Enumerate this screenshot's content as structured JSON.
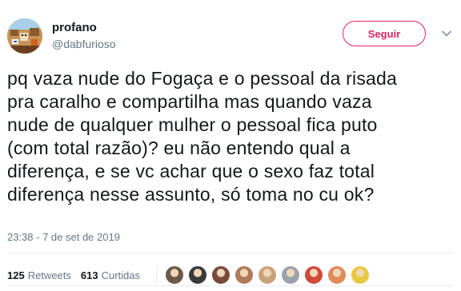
{
  "tweet": {
    "display_name": "profano",
    "handle": "@dabfurioso",
    "follow_label": "Seguir",
    "text": "pq vaza nude do Fogaça e o pessoal da risada\npra caralho e compartilha mas quando vaza\nnude de qualquer mulher o pessoal fica puto\n(com total razão)? eu não entendo qual a\ndiferença, e se vc achar que o sexo faz total\ndiferença nesse assunto, só toma no cu ok?",
    "timestamp": "23:38 - 7 de set de 2019",
    "retweets_count": "125",
    "retweets_label": "Retweets",
    "likes_count": "613",
    "likes_label": "Curtidas"
  },
  "colors": {
    "follow_accent": "#e0245e",
    "secondary_text": "#657786",
    "primary_text": "#14171a"
  },
  "likers": [
    {
      "icon": "liker-avatar-1",
      "color": "#6b5a4a"
    },
    {
      "icon": "liker-avatar-2",
      "color": "#3a3a3a"
    },
    {
      "icon": "liker-avatar-3",
      "color": "#7a4a3a"
    },
    {
      "icon": "liker-avatar-4",
      "color": "#b07a5a"
    },
    {
      "icon": "liker-avatar-5",
      "color": "#c9a27a"
    },
    {
      "icon": "liker-avatar-6",
      "color": "#9aa3ad"
    },
    {
      "icon": "liker-avatar-7",
      "color": "#d04a3a"
    },
    {
      "icon": "liker-avatar-8",
      "color": "#e08a5a"
    },
    {
      "icon": "liker-avatar-9",
      "color": "#e8c840"
    }
  ]
}
